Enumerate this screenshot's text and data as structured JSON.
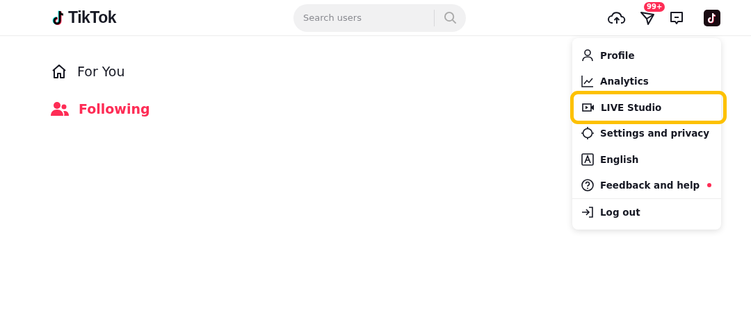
{
  "header": {
    "logo": "TikTok",
    "search": {
      "placeholder": "Search users"
    },
    "inbox_badge": "99+"
  },
  "sidebar": {
    "items": [
      {
        "kind": "home",
        "label": "For You",
        "selected": false
      },
      {
        "kind": "people",
        "label": "Following",
        "selected": true
      }
    ]
  },
  "menu": {
    "items": [
      {
        "kind": "profile",
        "label": "Profile",
        "highlighted": false,
        "dot": false
      },
      {
        "kind": "analytics",
        "label": "Analytics",
        "highlighted": false,
        "dot": false
      },
      {
        "kind": "live",
        "label": "LIVE Studio",
        "highlighted": true,
        "dot": false
      },
      {
        "kind": "settings",
        "label": "Settings and privacy",
        "highlighted": false,
        "dot": false
      },
      {
        "kind": "language",
        "label": "English",
        "highlighted": false,
        "dot": false
      },
      {
        "kind": "help",
        "label": "Feedback and help",
        "highlighted": false,
        "dot": true
      },
      {
        "kind": "logout",
        "label": "Log out",
        "highlighted": false,
        "dot": false
      }
    ]
  }
}
